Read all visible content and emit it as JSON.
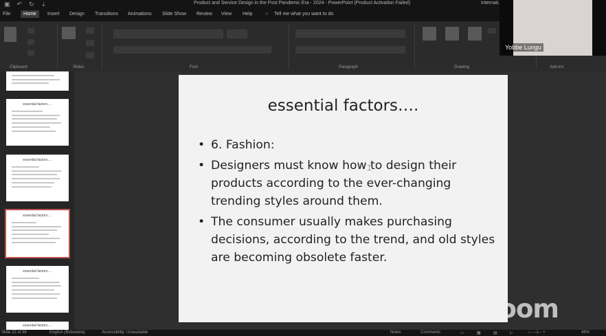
{
  "titlebar": {
    "title": "Product and Service Design in the Post Pandemic Era - 2024  -  PowerPoint (Product Activation Failed)",
    "right_label": "Internati..."
  },
  "tabs": [
    "File",
    "Home",
    "Insert",
    "Design",
    "Transitions",
    "Animations",
    "Slide Show",
    "Review",
    "View",
    "Help"
  ],
  "tell_me": "Tell me what you want to do",
  "ribbon_groups": [
    "Clipboard",
    "Slides",
    "Font",
    "Paragraph",
    "Drawing",
    "Add-ins"
  ],
  "slide": {
    "title": "essential factors….",
    "bullets": [
      "6. Fashion:",
      "Designers must know how to design their products according to the ever-changing trending styles around them.",
      "The consumer usually makes purchasing decisions, according to the trend, and old styles are becoming obsolete faster."
    ]
  },
  "thumbnail_title": "essential factors….",
  "webcam": {
    "name": "Yobbe Lungu"
  },
  "status": {
    "slide_count": "Slide 22 of 38",
    "language": "English (Botswana)",
    "accessibility": "Accessibility: Unavailable",
    "notes": "Notes",
    "comments": "Comments",
    "zoom": "46%"
  },
  "watermark": "zoom"
}
